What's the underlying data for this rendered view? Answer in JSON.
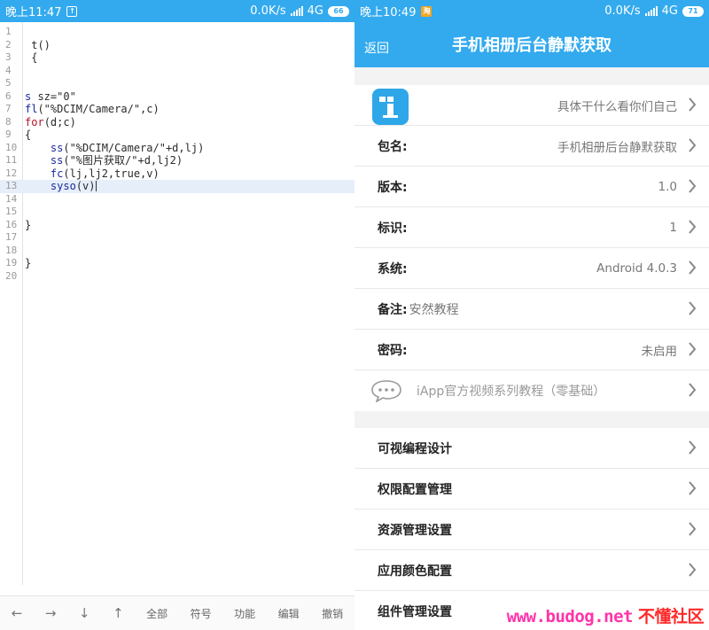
{
  "left": {
    "statusbar": {
      "time": "晚上11:47",
      "speed": "0.0K/s",
      "network": "4G",
      "battery": "66"
    },
    "code_lines": [
      {
        "n": "1",
        "tokens": []
      },
      {
        "n": "2",
        "tokens": [
          {
            "t": " t()",
            "c": "plain"
          }
        ]
      },
      {
        "n": "3",
        "tokens": [
          {
            "t": " {",
            "c": "plain"
          }
        ]
      },
      {
        "n": "4",
        "tokens": []
      },
      {
        "n": "5",
        "tokens": []
      },
      {
        "n": "6",
        "tokens": [
          {
            "t": "s",
            "c": "navy"
          },
          {
            "t": " sz=\"0\"",
            "c": "plain"
          }
        ]
      },
      {
        "n": "7",
        "tokens": [
          {
            "t": "fl",
            "c": "navy"
          },
          {
            "t": "(\"%DCIM/Camera/\",c)",
            "c": "plain"
          }
        ]
      },
      {
        "n": "8",
        "tokens": [
          {
            "t": "for",
            "c": "red"
          },
          {
            "t": "(d;c)",
            "c": "plain"
          }
        ]
      },
      {
        "n": "9",
        "tokens": [
          {
            "t": "{",
            "c": "plain"
          }
        ]
      },
      {
        "n": "10",
        "tokens": [
          {
            "t": "    ",
            "c": "plain"
          },
          {
            "t": "ss",
            "c": "navy"
          },
          {
            "t": "(\"%DCIM/Camera/\"+d,lj)",
            "c": "plain"
          }
        ]
      },
      {
        "n": "11",
        "tokens": [
          {
            "t": "    ",
            "c": "plain"
          },
          {
            "t": "ss",
            "c": "navy"
          },
          {
            "t": "(\"%图片获取/\"+d,lj2)",
            "c": "plain"
          }
        ]
      },
      {
        "n": "12",
        "tokens": [
          {
            "t": "    ",
            "c": "plain"
          },
          {
            "t": "fc",
            "c": "navy"
          },
          {
            "t": "(lj,lj2,true,v)",
            "c": "plain"
          }
        ]
      },
      {
        "n": "13",
        "tokens": [
          {
            "t": "    ",
            "c": "plain"
          },
          {
            "t": "syso",
            "c": "navy"
          },
          {
            "t": "(v)",
            "c": "plain"
          }
        ],
        "current": true
      },
      {
        "n": "14",
        "tokens": []
      },
      {
        "n": "15",
        "tokens": []
      },
      {
        "n": "16",
        "tokens": [
          {
            "t": "}",
            "c": "plain"
          }
        ]
      },
      {
        "n": "17",
        "tokens": []
      },
      {
        "n": "18",
        "tokens": []
      },
      {
        "n": "19",
        "tokens": [
          {
            "t": "}",
            "c": "plain"
          }
        ]
      },
      {
        "n": "20",
        "tokens": []
      }
    ],
    "toolbar": {
      "left_arrow": "←",
      "right_arrow": "→",
      "down_arrow": "↓",
      "up_arrow": "↑",
      "all": "全部",
      "symbol": "符号",
      "function": "功能",
      "edit": "编辑",
      "undo": "撤销"
    }
  },
  "right": {
    "statusbar": {
      "time": "晚上10:49",
      "notif": "淘",
      "speed": "0.0K/s",
      "network": "4G",
      "battery": "71"
    },
    "appbar": {
      "back": "返回",
      "title": "手机相册后台静默获取"
    },
    "info_rows": [
      {
        "id": "description",
        "label": "",
        "value": "具体干什么看你们自己"
      },
      {
        "id": "package",
        "label": "包名:",
        "value": "手机相册后台静默获取"
      },
      {
        "id": "version",
        "label": "版本:",
        "value": "1.0"
      },
      {
        "id": "identifier",
        "label": "标识:",
        "value": "1"
      },
      {
        "id": "system",
        "label": "系统:",
        "value": "Android 4.0.3"
      },
      {
        "id": "note",
        "label": "备注:",
        "inline_value": "安然教程"
      },
      {
        "id": "password",
        "label": "密码:",
        "value": "未启用"
      },
      {
        "id": "tutorial",
        "gray_label": "iApp官方视频系列教程（零基础）"
      }
    ],
    "menu_rows": [
      {
        "id": "visual-design",
        "label": "可视编程设计"
      },
      {
        "id": "permission-config",
        "label": "权限配置管理"
      },
      {
        "id": "resource-manage",
        "label": "资源管理设置"
      },
      {
        "id": "color-config",
        "label": "应用颜色配置"
      },
      {
        "id": "component-manage",
        "label": "组件管理设置"
      }
    ],
    "watermark": {
      "latin": "www.budog.net",
      "cn": "不懂社区"
    }
  },
  "colors": {
    "accent": "#33aaee",
    "keyword_red": "#b5122b",
    "keyword_navy": "#1a2a9c"
  }
}
